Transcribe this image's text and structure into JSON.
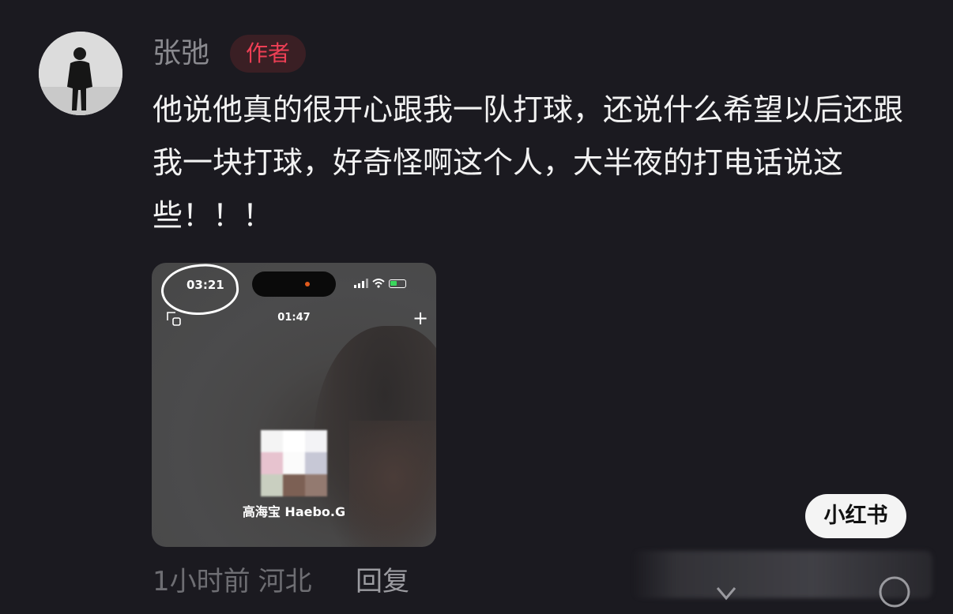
{
  "author": {
    "name": "张弛",
    "badge": "作者",
    "avatar_icon": "person-avatar"
  },
  "comment": {
    "text": "他说他真的很开心跟我一队打球，还说什么希望以后还跟我一块打球，好奇怪啊这个人，大半夜的打电话说这些！！！"
  },
  "screenshot": {
    "status_time": "03:21",
    "call_duration": "01:47",
    "contact_name": "高海宝 Haebo.G"
  },
  "meta": {
    "time": "1小时前",
    "location": "河北",
    "reply_label": "回复"
  },
  "watermark": "小红书",
  "colors": {
    "background": "#1b1a20",
    "badge_text": "#ee3f55",
    "text_primary": "#f2f2f2",
    "text_secondary": "#6e6e73"
  }
}
